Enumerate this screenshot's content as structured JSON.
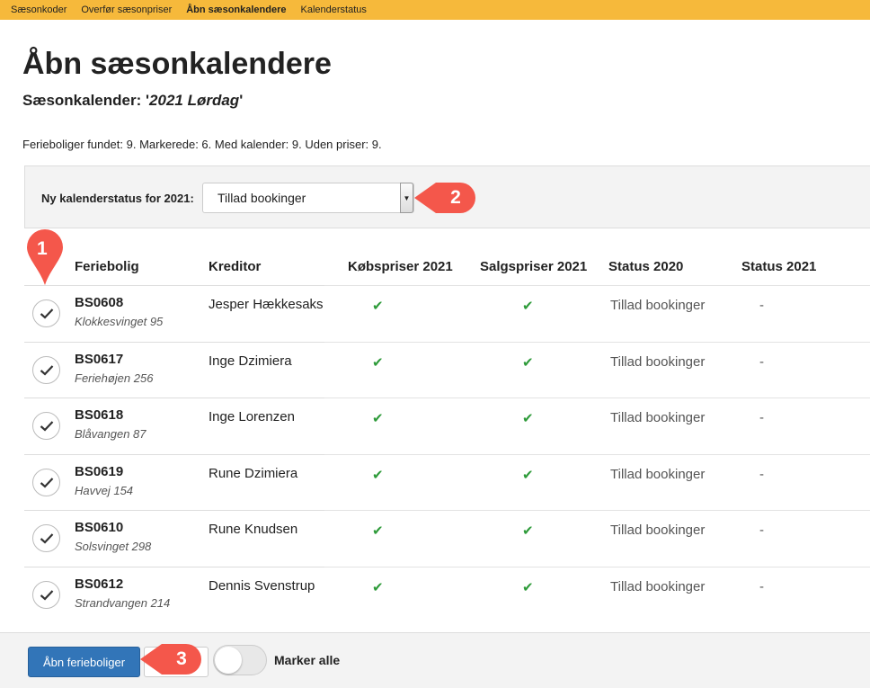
{
  "nav": {
    "tabs": [
      {
        "label": "Sæsonkoder"
      },
      {
        "label": "Overfør sæsonpriser"
      },
      {
        "label": "Åbn sæsonkalendere",
        "active": true
      },
      {
        "label": "Kalenderstatus"
      }
    ]
  },
  "page": {
    "title": "Åbn sæsonkalendere",
    "subtitle_prefix": "Sæsonkalender: '",
    "calendar_name": "2021 Lørdag",
    "subtitle_suffix": "'",
    "stats": "Ferieboliger fundet: 9. Markerede: 6. Med kalender: 9. Uden priser: 9."
  },
  "status_panel": {
    "label": "Ny kalenderstatus for 2021:",
    "selected_value": "Tillad bookinger"
  },
  "callouts": [
    "1",
    "2",
    "3"
  ],
  "table": {
    "headers": [
      "Feriebolig",
      "Kreditor",
      "Købspriser 2021",
      "Salgspriser 2021",
      "Status 2020",
      "Status 2021"
    ],
    "rows": [
      {
        "code": "BS0608",
        "address": "Klokkesvinget 95",
        "creditor": "Jesper Hækkesaks",
        "purchase_prices": "✔",
        "sales_prices": "✔",
        "status_2020": "Tillad bookinger",
        "status_2021": "-",
        "checked": true
      },
      {
        "code": "BS0617",
        "address": "Feriehøjen 256",
        "creditor": "Inge Dzimiera",
        "purchase_prices": "✔",
        "sales_prices": "✔",
        "status_2020": "Tillad bookinger",
        "status_2021": "-",
        "checked": true
      },
      {
        "code": "BS0618",
        "address": "Blåvangen 87",
        "creditor": "Inge Lorenzen",
        "purchase_prices": "✔",
        "sales_prices": "✔",
        "status_2020": "Tillad bookinger",
        "status_2021": "-",
        "checked": true
      },
      {
        "code": "BS0619",
        "address": "Havvej 154",
        "creditor": "Rune Dzimiera",
        "purchase_prices": "✔",
        "sales_prices": "✔",
        "status_2020": "Tillad bookinger",
        "status_2021": "-",
        "checked": true
      },
      {
        "code": "BS0610",
        "address": "Solsvinget 298",
        "creditor": "Rune Knudsen",
        "purchase_prices": "✔",
        "sales_prices": "✔",
        "status_2020": "Tillad bookinger",
        "status_2021": "-",
        "checked": true
      },
      {
        "code": "BS0612",
        "address": "Strandvangen 214",
        "creditor": "Dennis Svenstrup",
        "purchase_prices": "✔",
        "sales_prices": "✔",
        "status_2020": "Tillad bookinger",
        "status_2021": "-",
        "checked": true
      }
    ]
  },
  "footer": {
    "open_button": "Åbn ferieboliger",
    "toggle_label": "Marker alle"
  },
  "colors": {
    "nav_bg": "#f6b93b",
    "primary_button": "#3275b8",
    "callout": "#f4574b",
    "check_green": "#2e9b3a"
  }
}
